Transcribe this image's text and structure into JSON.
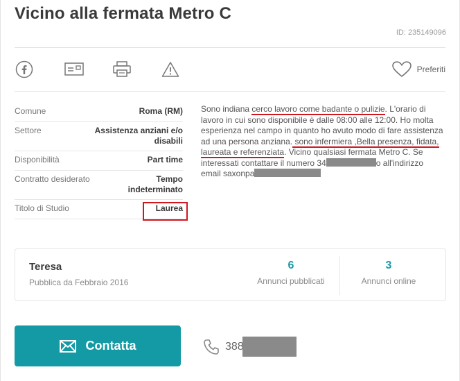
{
  "listing": {
    "title": "Vicino alla fermata Metro C",
    "id_label": "ID: 235149096"
  },
  "actions": {
    "icons": [
      "facebook-icon",
      "email-icon",
      "print-icon",
      "warning-icon"
    ],
    "favorite_label": "Preferiti"
  },
  "details": [
    {
      "label": "Comune",
      "value": "Roma (RM)"
    },
    {
      "label": "Settore",
      "value": "Assistenza anziani e/o disabili"
    },
    {
      "label": "Disponibilità",
      "value": "Part time"
    },
    {
      "label": "Contratto desiderato",
      "value": "Tempo indeterminato"
    },
    {
      "label": "Titolo di Studio",
      "value": "Laurea"
    }
  ],
  "description": {
    "p1": "Sono indiana ",
    "u1": "cerco lavoro come badante o pulizie",
    "p2": ". L'orario di lavoro in cui sono disponibile è dalle 08:00 alle 12:00. Ho molta esperienza nel campo in quanto ho avuto modo di fare assistenza ad una persona anziana.",
    "u2": " sono infermiera ,Bella presenza, fidata, laureata e referenziata",
    "p3": ". Vicino qualsiasi fermata Metro C. Se interessati contattare il numero ",
    "phone_prefix": "34",
    "p4": "o all'indirizzo email saxonpa"
  },
  "profile": {
    "name": "Teresa",
    "since": "Pubblica da Febbraio 2016",
    "ads_count": "6",
    "ads_label": "Annunci pubblicati",
    "online_count": "3",
    "online_label": "Annunci online"
  },
  "contact": {
    "button_label": "Contatta",
    "phone_prefix": "388"
  },
  "colors": {
    "accent": "#139aa4",
    "highlight_red": "#d0161f"
  }
}
